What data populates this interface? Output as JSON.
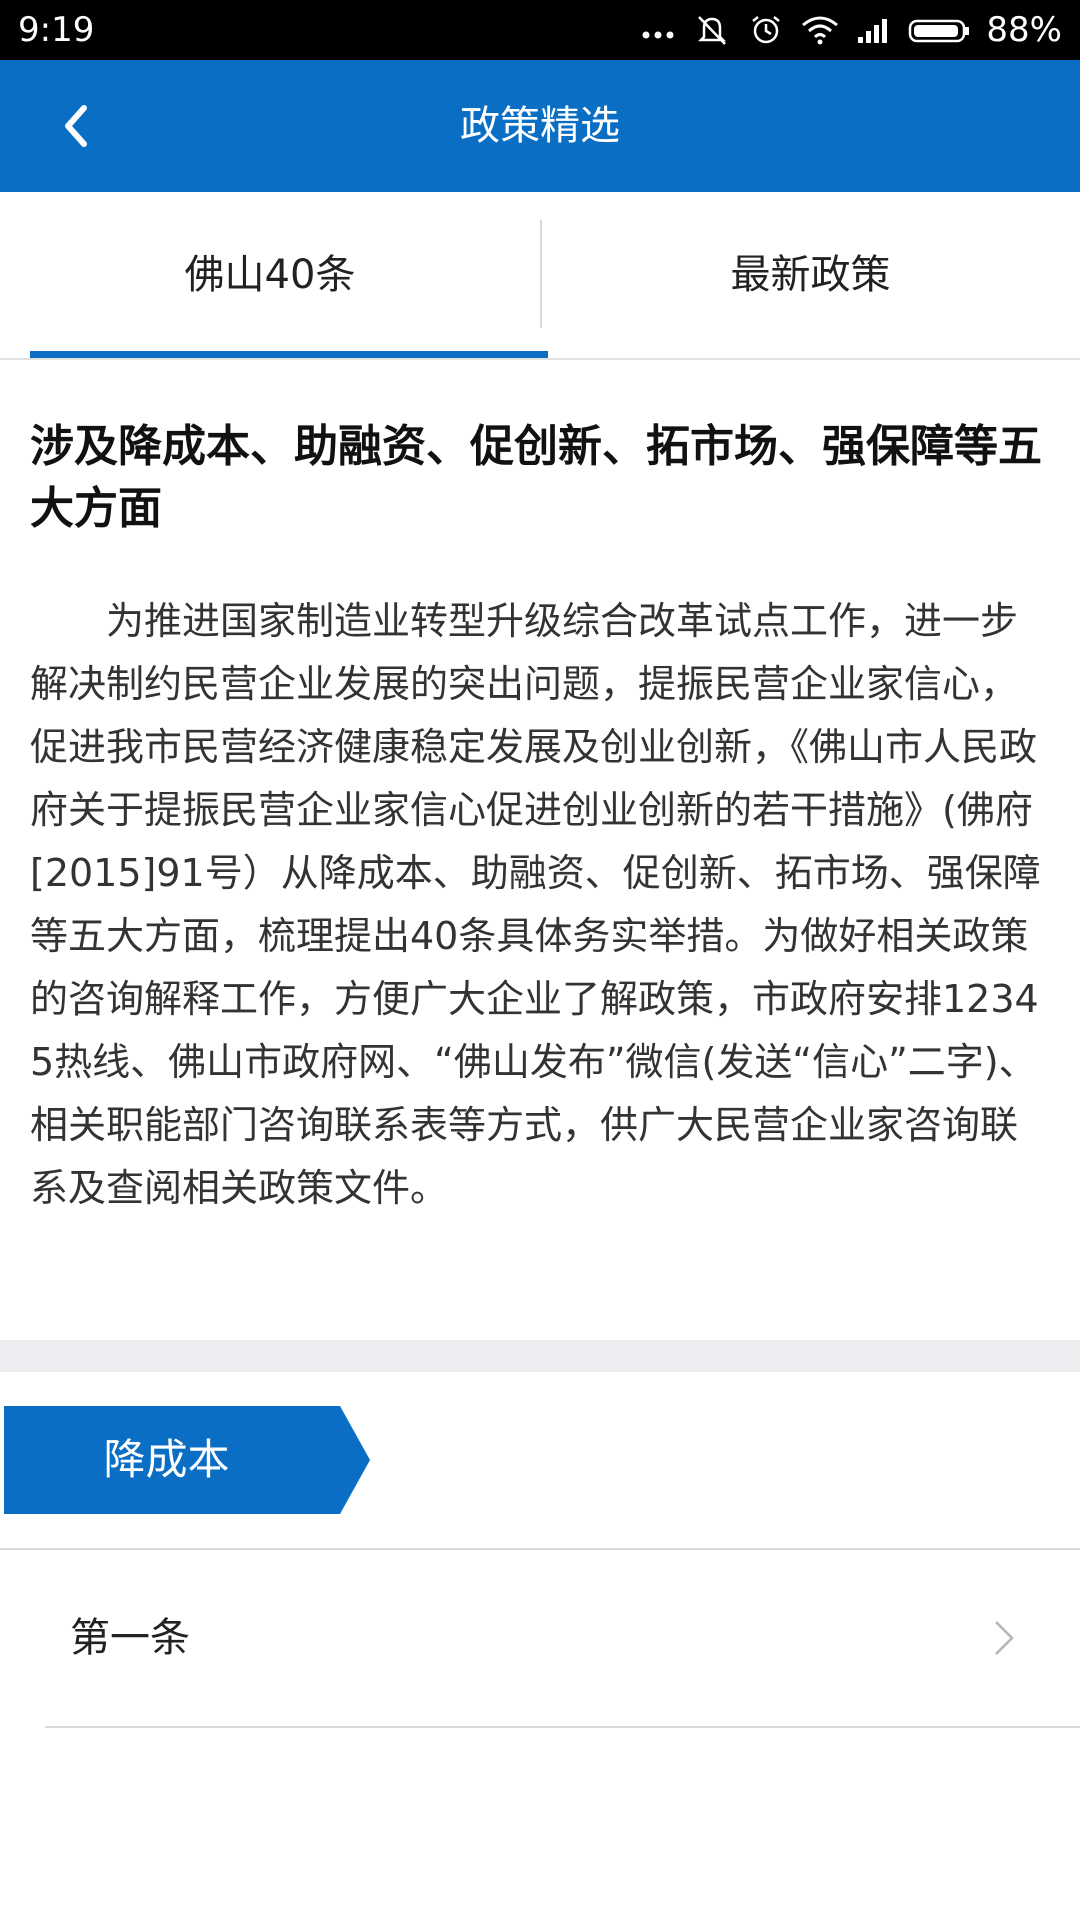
{
  "status_bar": {
    "time": "9:19",
    "battery": "88%",
    "icons": [
      "more-dots-icon",
      "bell-muted-icon",
      "alarm-icon",
      "wifi-icon",
      "signal-icon",
      "battery-icon"
    ]
  },
  "app_bar": {
    "title": "政策精选",
    "back_icon": "chevron-left-icon"
  },
  "tabs": [
    {
      "label": "佛山40条",
      "selected": true
    },
    {
      "label": "最新政策",
      "selected": false
    }
  ],
  "article": {
    "headline": "涉及降成本、助融资、促创新、拓市场、强保障等五大方面",
    "body": "为推进国家制造业转型升级综合改革试点工作，进一步解决制约民营企业发展的突出问题，提振民营企业家信心，促进我市民营经济健康稳定发展及创业创新，《佛山市人民政府关于提振民营企业家信心促进创业创新的若干措施》(佛府[2015]91号）从降成本、助融资、促创新、拓市场、强保障等五大方面，梳理提出40条具体务实举措。为做好相关政策的咨询解释工作，方便广大企业了解政策，市政府安排12345热线、佛山市政府网、“佛山发布”微信(发送“信心”二字)、相关职能部门咨询联系表等方式，供广大民营企业家咨询联系及查阅相关政策文件。"
  },
  "section": {
    "label": "降成本",
    "items": [
      {
        "label": "第一条",
        "icon": "chevron-right-icon"
      }
    ]
  },
  "colors": {
    "primary": "#0a6fc4",
    "band": "#eeeef2"
  }
}
